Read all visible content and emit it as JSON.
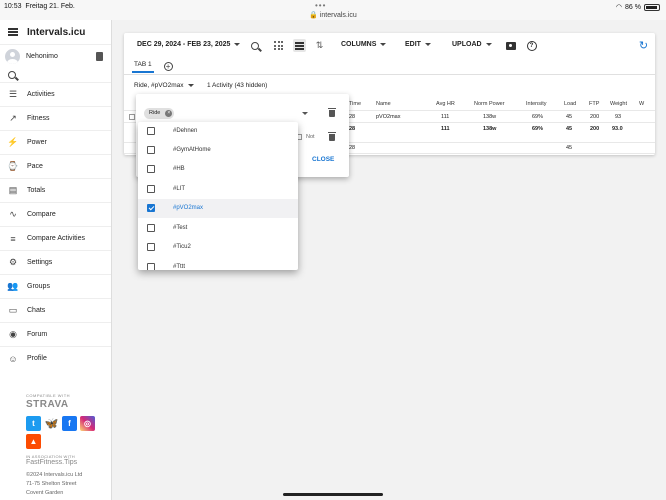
{
  "status": {
    "time": "10:53",
    "date": "Freitag 21. Feb.",
    "url": "intervals.icu",
    "battery": "86 %"
  },
  "sidebar": {
    "brand": "Intervals.icu",
    "user": "Nehonimo",
    "items": [
      {
        "label": "Activities",
        "icon": "list-icon"
      },
      {
        "label": "Fitness",
        "icon": "trend-icon"
      },
      {
        "label": "Power",
        "icon": "bolt-icon"
      },
      {
        "label": "Pace",
        "icon": "watch-icon"
      },
      {
        "label": "Totals",
        "icon": "chart-icon"
      },
      {
        "label": "Compare",
        "icon": "compare-icon"
      },
      {
        "label": "Compare Activities",
        "icon": "compare-list-icon"
      },
      {
        "label": "Settings",
        "icon": "gear-icon"
      },
      {
        "label": "Groups",
        "icon": "group-icon"
      },
      {
        "label": "Chats",
        "icon": "chat-icon"
      },
      {
        "label": "Forum",
        "icon": "forum-icon"
      },
      {
        "label": "Profile",
        "icon": "face-icon"
      }
    ],
    "footer": {
      "compatible": "COMPATIBLE WITH",
      "strava": "STRAVA",
      "association": "IN ASSOCIATION WITH",
      "fastfitness": "FastFitness.Tips",
      "copyright": "©2024 Intervals.icu Ltd",
      "street": "71-75 Shelton Street",
      "area": "Covent Garden"
    },
    "social_colors": {
      "twitter": "#1d9bf0",
      "bluesky": "#1185fe",
      "facebook": "#1877f2",
      "instagram": "#d6249f",
      "strava": "#fc4c02"
    }
  },
  "toolbar": {
    "date_range": "DEC 29, 2024 - FEB 23, 2025",
    "columns": "COLUMNS",
    "edit": "EDIT",
    "upload": "UPLOAD",
    "help": "?"
  },
  "tabs": [
    {
      "label": "TAB 1"
    }
  ],
  "filter": {
    "label": "Ride, #pVO2max",
    "count": "1 Activity (43 hidden)"
  },
  "table": {
    "headers": [
      "Time",
      "Name",
      "Avg HR",
      "Norm Power",
      "Intensity",
      "Load",
      "FTP",
      "Weight",
      "W"
    ],
    "row": {
      "time": "28",
      "name": "pVO2max",
      "avg_hr": "111",
      "norm_power": "138w",
      "intensity": "69%",
      "load": "45",
      "ftp": "200",
      "weight": "93"
    },
    "summary": {
      "time": "28",
      "avg_hr": "111",
      "norm_power": "138w",
      "intensity": "69%",
      "load": "45",
      "ftp": "200",
      "weight": "93.0"
    },
    "total": {
      "time": "28",
      "load": "45"
    }
  },
  "panel": {
    "chip": "Ride",
    "not_label": "Not",
    "close": "CLOSE"
  },
  "dropdown": {
    "items": [
      {
        "label": "#Dehnen",
        "checked": false
      },
      {
        "label": "#GymAtHome",
        "checked": false
      },
      {
        "label": "#HB",
        "checked": false
      },
      {
        "label": "#LIT",
        "checked": false
      },
      {
        "label": "#pVO2max",
        "checked": true
      },
      {
        "label": "#Test",
        "checked": false
      },
      {
        "label": "#Ticu2",
        "checked": false
      },
      {
        "label": "#Tttt",
        "checked": false
      }
    ]
  },
  "accent_color": "#1976d2"
}
